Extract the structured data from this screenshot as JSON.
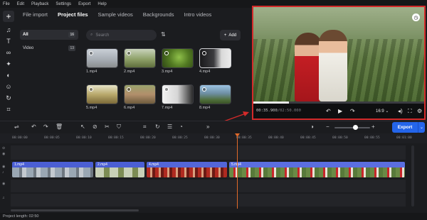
{
  "menu": [
    "File",
    "Edit",
    "Playback",
    "Settings",
    "Export",
    "Help"
  ],
  "media_tabs": [
    "File import",
    "Project files",
    "Sample videos",
    "Backgrounds",
    "Intro videos"
  ],
  "categories": [
    {
      "label": "All",
      "count": "16"
    },
    {
      "label": "Video",
      "count": "13"
    }
  ],
  "search": {
    "placeholder": "Search"
  },
  "add_button": "Add",
  "files": [
    "1.mp4",
    "2.mp4",
    "3.mp4",
    "4.mp4",
    "5.mp4",
    "6.mp4",
    "7.mp4",
    "8.mp4"
  ],
  "player": {
    "timecode_current": "00:35.900",
    "timecode_total": "/02:50.000",
    "aspect_ratio": "16:9",
    "progress_fraction": 0.21
  },
  "timeline": {
    "export_label": "Export",
    "ruler": [
      "00:00:00",
      "00:00:05",
      "00:00:10",
      "00:00:15",
      "00:00:20",
      "00:00:25",
      "00:00:30",
      "00:00:35",
      "00:00:40",
      "00:00:45",
      "00:00:50",
      "00:00:55",
      "00:01:00"
    ],
    "clips": [
      "1.mp4",
      "2.mp4",
      "4.mp4",
      "5.mp4"
    ]
  },
  "status": {
    "project_length": "Project length: 02:50"
  },
  "colors": {
    "accent": "#2465ea",
    "callout": "#d42a2a",
    "playhead": "#e06a2a",
    "clip": "#4b5fd4"
  }
}
